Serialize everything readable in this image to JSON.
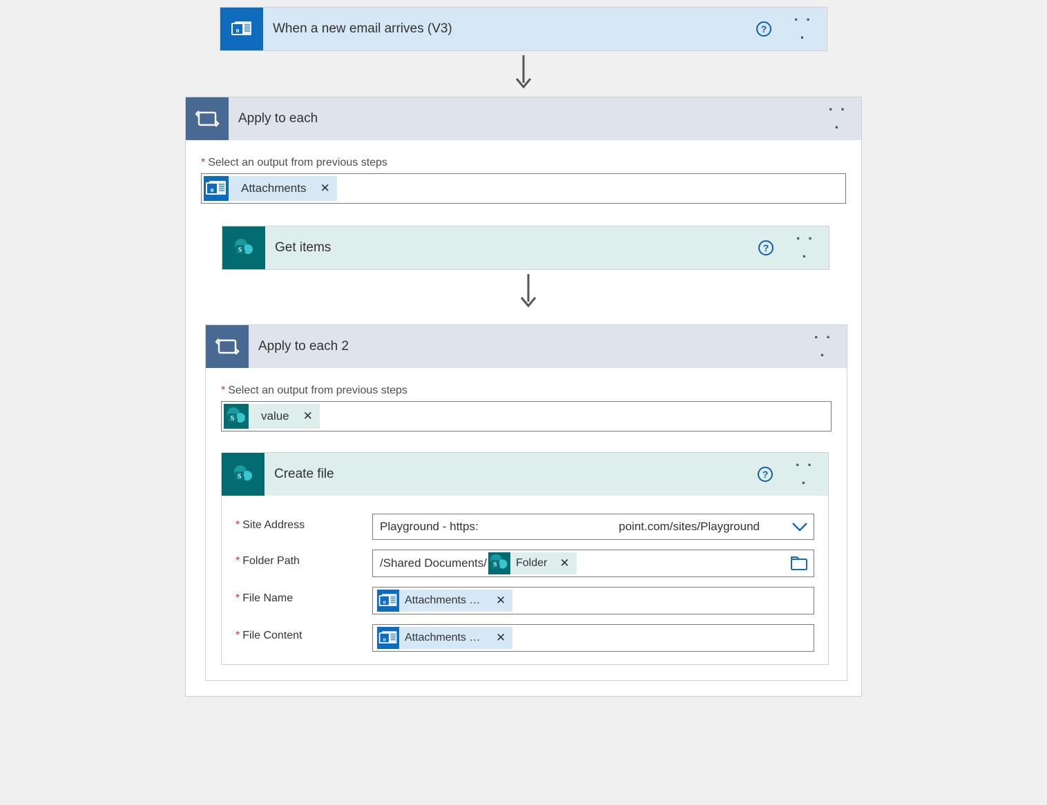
{
  "trigger": {
    "title": "When a new email arrives (V3)"
  },
  "loop1": {
    "title": "Apply to each",
    "select_label": "Select an output from previous steps",
    "token": "Attachments"
  },
  "getitems": {
    "title": "Get items"
  },
  "loop2": {
    "title": "Apply to each 2",
    "select_label": "Select an output from previous steps",
    "token": "value"
  },
  "createfile": {
    "title": "Create file",
    "fields": {
      "site_label": "Site Address",
      "site_value_left": "Playground - https:",
      "site_value_right": "point.com/sites/Playground",
      "folder_label": "Folder Path",
      "folder_prefix": "/Shared Documents/",
      "folder_token": "Folder",
      "filename_label": "File Name",
      "filename_token": "Attachments N…",
      "filecontent_label": "File Content",
      "filecontent_token": "Attachments C…"
    }
  },
  "glyphs": {
    "x": "✕",
    "ellipsis": "· · ·",
    "question": "?"
  }
}
